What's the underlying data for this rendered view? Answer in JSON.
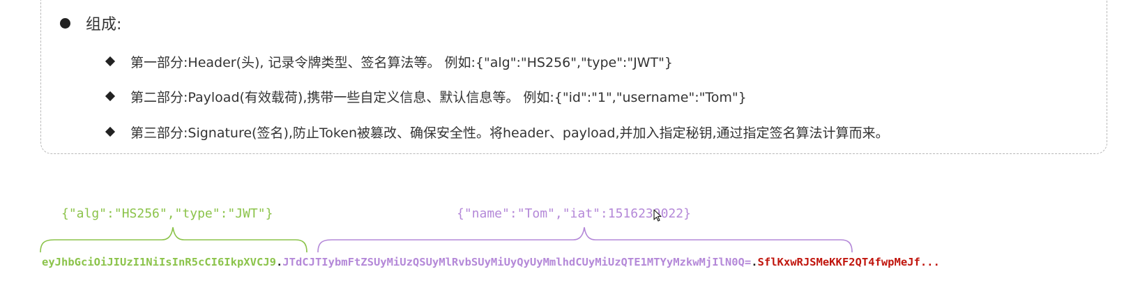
{
  "composition": {
    "title": "组成:",
    "items": [
      "第一部分:Header(头),  记录令牌类型、签名算法等。 例如:{\"alg\":\"HS256\",\"type\":\"JWT\"}",
      "第二部分:Payload(有效载荷),携带一些自定义信息、默认信息等。 例如:{\"id\":\"1\",\"username\":\"Tom\"}",
      "第三部分:Signature(签名),防止Token被篡改、确保安全性。将header、payload,并加入指定秘钥,通过指定签名算法计算而来。"
    ]
  },
  "diagram": {
    "header_label": "{\"alg\":\"HS256\",\"type\":\"JWT\"}",
    "payload_label": "{\"name\":\"Tom\",\"iat\":1516239022}",
    "token_header": "eyJhbGciOiJIUzI1NiIsInR5cCI6IkpXVCJ9",
    "token_dot1": ".",
    "token_payload": "JTdCJTIybmFtZSUyMiUzQSUyMlRvbSUyMiUyQyUyMmlhdCUyMiUzQTE1MTYyMzkwMjIlN0Q=",
    "token_dot2": ".",
    "token_signature": "SflKxwRJSMeKKF2QT4fwpMeJf..."
  },
  "colors": {
    "header": "#8bc34a",
    "payload": "#b488d8",
    "signature": "#c0150d"
  }
}
